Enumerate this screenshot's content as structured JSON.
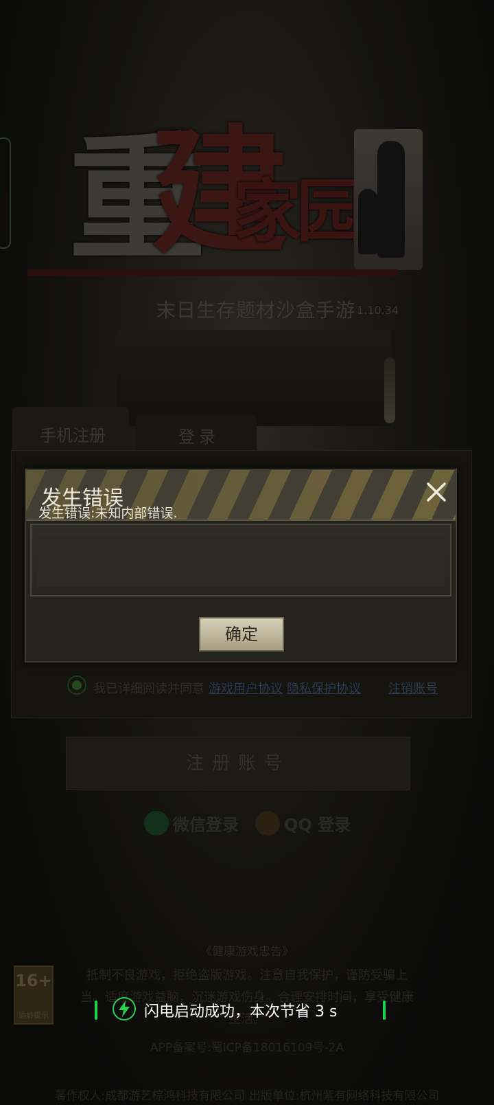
{
  "game": {
    "logo_text_1": "重",
    "logo_text_2": "建",
    "logo_text_3": "家园",
    "subtitle": "末日生存题材沙盒手游",
    "version": "1.10.34"
  },
  "tabs": {
    "register": "手机注册",
    "login": "登录"
  },
  "agreement": {
    "text": "我已详细阅读并同意",
    "user_agreement": "游戏用户协议",
    "privacy": "隐私保护协议",
    "cancel_account": "注销账号"
  },
  "register_button": "注册账号",
  "social": {
    "wechat": "微信登录",
    "qq": "QQ 登录"
  },
  "footer": {
    "health_title": "《健康游戏忠告》",
    "health_body": "抵制不良游戏，拒绝盗版游戏。注意自我保护，谨防受骗上当。适度游戏益脑，沉迷游戏伤身。合理安排时间，享受健康生活。",
    "age_rating": "16+",
    "age_caption": "适龄提示",
    "icp": "APP备案号:蜀ICP备18016109号-2A",
    "copyright": "著作权人:成都游艺棕鸿科技有限公司 出版单位:杭州紫有网络科技有限公司"
  },
  "modal": {
    "title": "发生错误",
    "message": "发生错误:未知内部错误.",
    "confirm": "确定",
    "close_icon": "close-icon"
  },
  "toast": {
    "text": "闪电启动成功，本次节省 3 s",
    "icon": "lightning-bolt-icon",
    "accent_color": "#1fd24a"
  }
}
